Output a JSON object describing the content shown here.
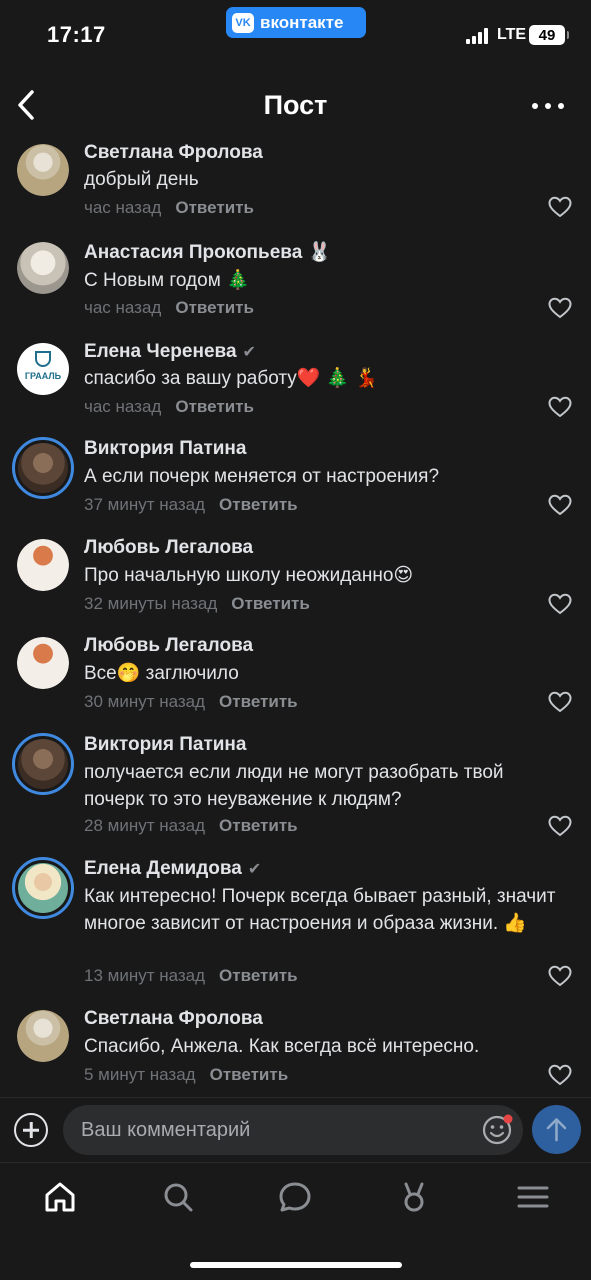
{
  "status_bar": {
    "time": "17:17",
    "app_badge": "вконтакте",
    "network": "LTE",
    "battery": "49"
  },
  "header": {
    "title": "Пост",
    "back_icon": "chevron-left-icon",
    "more_icon": "more-horizontal-icon"
  },
  "comments": [
    {
      "author": "Светлана Фролова",
      "text": "добрый день",
      "time": "час назад",
      "reply": "Ответить",
      "verified": false,
      "emoji_badge": ""
    },
    {
      "author": "Анастасия Прокопьева",
      "text": "С Новым годом 🎄",
      "time": "час назад",
      "reply": "Ответить",
      "verified": false,
      "emoji_badge": "🐰"
    },
    {
      "author": "Елена Черенева",
      "text": "спасибо за вашу работу❤️ 🎄 💃",
      "time": "час назад",
      "reply": "Ответить",
      "verified": true,
      "emoji_badge": "",
      "avatar_text": "ГРААЛЬ"
    },
    {
      "author": "Виктория Патина",
      "text": "А если почерк меняется от настроения?",
      "time": "37 минут назад",
      "reply": "Ответить",
      "verified": false,
      "emoji_badge": ""
    },
    {
      "author": "Любовь Легалова",
      "text": "Про начальную школу неожиданно😍",
      "time": "32 минуты назад",
      "reply": "Ответить",
      "verified": false,
      "emoji_badge": ""
    },
    {
      "author": "Любовь Легалова",
      "text": "Все🤭 заглючило",
      "time": "30 минут назад",
      "reply": "Ответить",
      "verified": false,
      "emoji_badge": ""
    },
    {
      "author": "Виктория Патина",
      "text": "получается если  люди не могут разобрать твой почерк то это неуважение к людям?",
      "time": "28 минут назад",
      "reply": "Ответить",
      "verified": false,
      "emoji_badge": ""
    },
    {
      "author": "Елена Демидова",
      "text": "Как интересно! Почерк всегда бывает разный, значит многое зависит от настроения и образа жизни. 👍",
      "time": "13 минут назад",
      "reply": "Ответить",
      "verified": true,
      "emoji_badge": ""
    },
    {
      "author": "Светлана Фролова",
      "text": "Спасибо, Анжела. Как всегда всё интересно.",
      "time": "5 минут назад",
      "reply": "Ответить",
      "verified": false,
      "emoji_badge": ""
    }
  ],
  "composer": {
    "placeholder": "Ваш комментарий"
  },
  "colors": {
    "background": "#19191a",
    "accent": "#2787f5",
    "secondary_text": "#6f7276",
    "story_ring": "#3f8ae0"
  }
}
